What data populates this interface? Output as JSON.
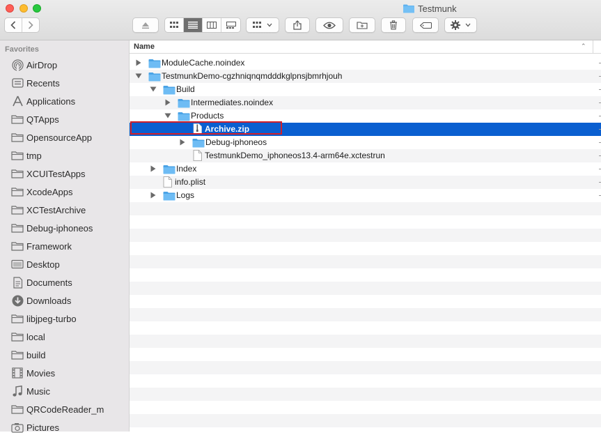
{
  "window": {
    "title": "Testmunk"
  },
  "toolbar": {
    "buttons": [
      "back",
      "forward",
      "eject",
      "icon-view",
      "list-view",
      "column-view",
      "gallery-view",
      "group",
      "share",
      "quick-look",
      "new-folder",
      "trash",
      "tags",
      "action"
    ]
  },
  "sidebar": {
    "section": "Favorites",
    "items": [
      {
        "label": "AirDrop",
        "icon": "airdrop-icon"
      },
      {
        "label": "Recents",
        "icon": "recents-icon"
      },
      {
        "label": "Applications",
        "icon": "applications-icon"
      },
      {
        "label": "QTApps",
        "icon": "folder-icon"
      },
      {
        "label": "OpensourceApp",
        "icon": "folder-icon"
      },
      {
        "label": "tmp",
        "icon": "folder-icon"
      },
      {
        "label": "XCUITestApps",
        "icon": "folder-icon"
      },
      {
        "label": "XcodeApps",
        "icon": "folder-icon"
      },
      {
        "label": "XCTestArchive",
        "icon": "folder-icon"
      },
      {
        "label": "Debug-iphoneos",
        "icon": "folder-icon"
      },
      {
        "label": "Framework",
        "icon": "folder-icon"
      },
      {
        "label": "Desktop",
        "icon": "desktop-icon"
      },
      {
        "label": "Documents",
        "icon": "documents-icon"
      },
      {
        "label": "Downloads",
        "icon": "downloads-icon"
      },
      {
        "label": "libjpeg-turbo",
        "icon": "folder-icon"
      },
      {
        "label": "local",
        "icon": "folder-icon"
      },
      {
        "label": "build",
        "icon": "folder-icon"
      },
      {
        "label": "Movies",
        "icon": "movies-icon"
      },
      {
        "label": "Music",
        "icon": "music-icon"
      },
      {
        "label": "QRCodeReader_m",
        "icon": "folder-icon"
      },
      {
        "label": "Pictures",
        "icon": "pictures-icon"
      }
    ]
  },
  "list": {
    "column_name": "Name",
    "rows": [
      {
        "label": "ModuleCache.noindex",
        "depth": 0,
        "type": "folder",
        "disclosure": "collapsed"
      },
      {
        "label": "TestmunkDemo-cgzhniqnqmdddkglpnsjbmrhjouh",
        "depth": 0,
        "type": "folder",
        "disclosure": "expanded"
      },
      {
        "label": "Build",
        "depth": 1,
        "type": "folder",
        "disclosure": "expanded"
      },
      {
        "label": "Intermediates.noindex",
        "depth": 2,
        "type": "folder",
        "disclosure": "collapsed"
      },
      {
        "label": "Products",
        "depth": 2,
        "type": "folder",
        "disclosure": "expanded"
      },
      {
        "label": "Archive.zip",
        "depth": 3,
        "type": "zip",
        "disclosure": "none",
        "selected": true
      },
      {
        "label": "Debug-iphoneos",
        "depth": 3,
        "type": "folder",
        "disclosure": "collapsed"
      },
      {
        "label": "TestmunkDemo_iphoneos13.4-arm64e.xctestrun",
        "depth": 3,
        "type": "file",
        "disclosure": "none"
      },
      {
        "label": "Index",
        "depth": 1,
        "type": "folder",
        "disclosure": "collapsed"
      },
      {
        "label": "info.plist",
        "depth": 1,
        "type": "file",
        "disclosure": "none"
      },
      {
        "label": "Logs",
        "depth": 1,
        "type": "folder",
        "disclosure": "collapsed"
      }
    ]
  },
  "colors": {
    "selection": "#0a5fd0",
    "folder": "#5fb3f0",
    "highlight_box": "#d0202a"
  }
}
